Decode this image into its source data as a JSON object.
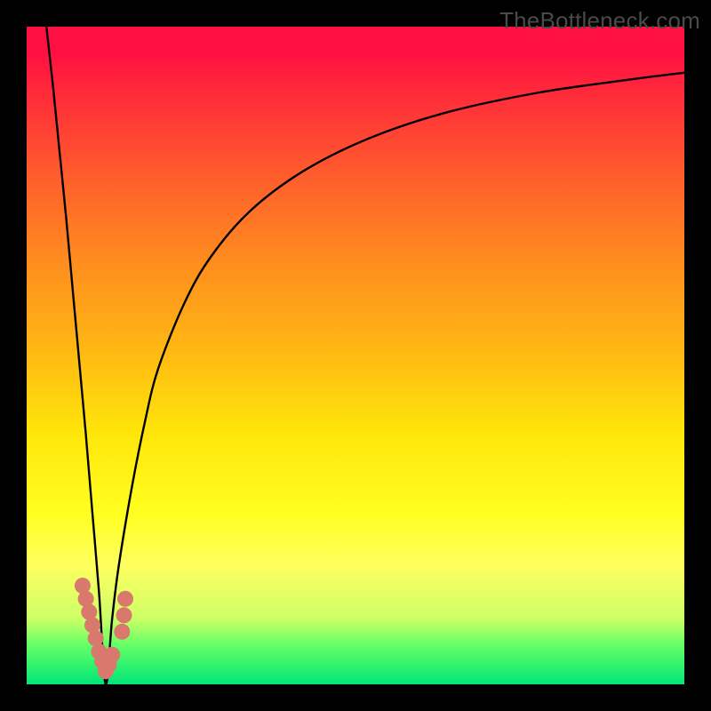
{
  "watermark": "TheBottleneck.com",
  "colors": {
    "black": "#000000",
    "curve": "#000000",
    "marker_fill": "#d9786c",
    "marker_stroke": "#c45f54"
  },
  "chart_data": {
    "type": "line",
    "title": "",
    "xlabel": "",
    "ylabel": "",
    "xlim": [
      0,
      100
    ],
    "ylim": [
      0,
      100
    ],
    "x_optimum": 12,
    "series": [
      {
        "name": "bottleneck-curve",
        "description": "V-shaped bottleneck curve: steep descent from top-left to minimum near x≈12, then asymptotic rise toward top right",
        "x": [
          3,
          4,
          5,
          6,
          7,
          8,
          9,
          10,
          11,
          12,
          13,
          14,
          16,
          18,
          20,
          24,
          28,
          34,
          42,
          52,
          64,
          78,
          92,
          100
        ],
        "y": [
          100,
          91,
          81,
          71,
          60,
          49,
          38,
          26,
          14,
          0,
          10,
          18,
          30,
          40,
          48,
          58,
          65,
          72,
          78,
          83,
          87,
          90,
          92,
          93
        ]
      }
    ],
    "markers": {
      "name": "highlighted-points",
      "description": "Salmon-colored dots clustered around the minimum of the curve",
      "points": [
        {
          "x": 8.5,
          "y": 15
        },
        {
          "x": 9.0,
          "y": 13
        },
        {
          "x": 9.5,
          "y": 11
        },
        {
          "x": 10.0,
          "y": 9
        },
        {
          "x": 10.5,
          "y": 7
        },
        {
          "x": 11.0,
          "y": 5
        },
        {
          "x": 11.5,
          "y": 3.5
        },
        {
          "x": 12.0,
          "y": 2
        },
        {
          "x": 12.5,
          "y": 3
        },
        {
          "x": 13.0,
          "y": 4.5
        },
        {
          "x": 14.5,
          "y": 8
        },
        {
          "x": 14.8,
          "y": 10.5
        },
        {
          "x": 15.0,
          "y": 13
        }
      ]
    }
  }
}
